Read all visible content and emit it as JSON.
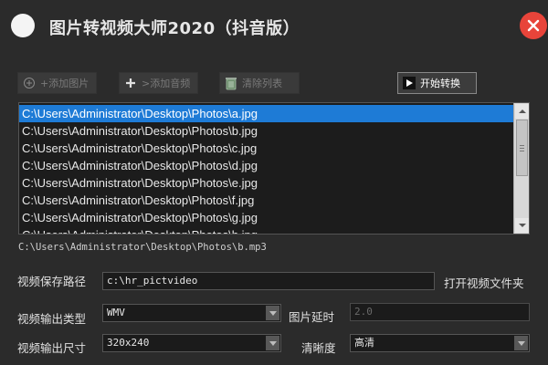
{
  "window": {
    "title": "图片转视频大师2020（抖音版）"
  },
  "toolbar": {
    "add_image": "+添加图片",
    "add_audio": ">添加音频",
    "clear_list": "清除列表",
    "start_convert": "开始转换"
  },
  "file_list": {
    "items": [
      "C:\\Users\\Administrator\\Desktop\\Photos\\a.jpg",
      "C:\\Users\\Administrator\\Desktop\\Photos\\b.jpg",
      "C:\\Users\\Administrator\\Desktop\\Photos\\c.jpg",
      "C:\\Users\\Administrator\\Desktop\\Photos\\d.jpg",
      "C:\\Users\\Administrator\\Desktop\\Photos\\e.jpg",
      "C:\\Users\\Administrator\\Desktop\\Photos\\f.jpg",
      "C:\\Users\\Administrator\\Desktop\\Photos\\g.jpg",
      "C:\\Users\\Administrator\\Desktop\\Photos\\h.jpg"
    ],
    "selected_index": 0
  },
  "audio": {
    "path": "C:\\Users\\Administrator\\Desktop\\Photos\\b.mp3"
  },
  "settings": {
    "save_path_label": "视频保存路径",
    "save_path_value": "c:\\hr_pictvideo",
    "open_folder": "打开视频文件夹",
    "output_type_label": "视频输出类型",
    "output_type_value": "WMV",
    "image_delay_label": "图片延时",
    "image_delay_value": "2.0",
    "output_size_label": "视频输出尺寸",
    "output_size_value": "320x240",
    "clarity_label": "清晰度",
    "clarity_value": "高清"
  },
  "colors": {
    "background": "#2b2b2b",
    "list_background": "#1c1c1c",
    "selection": "#1e7bd6",
    "close_button": "#e8443a"
  },
  "icons": {
    "logo": "circle-logo",
    "close": "close-icon",
    "add_image": "add-image-icon",
    "add_audio": "plus-icon",
    "clear_list": "recycle-bin-icon",
    "start_convert": "play-icon"
  }
}
